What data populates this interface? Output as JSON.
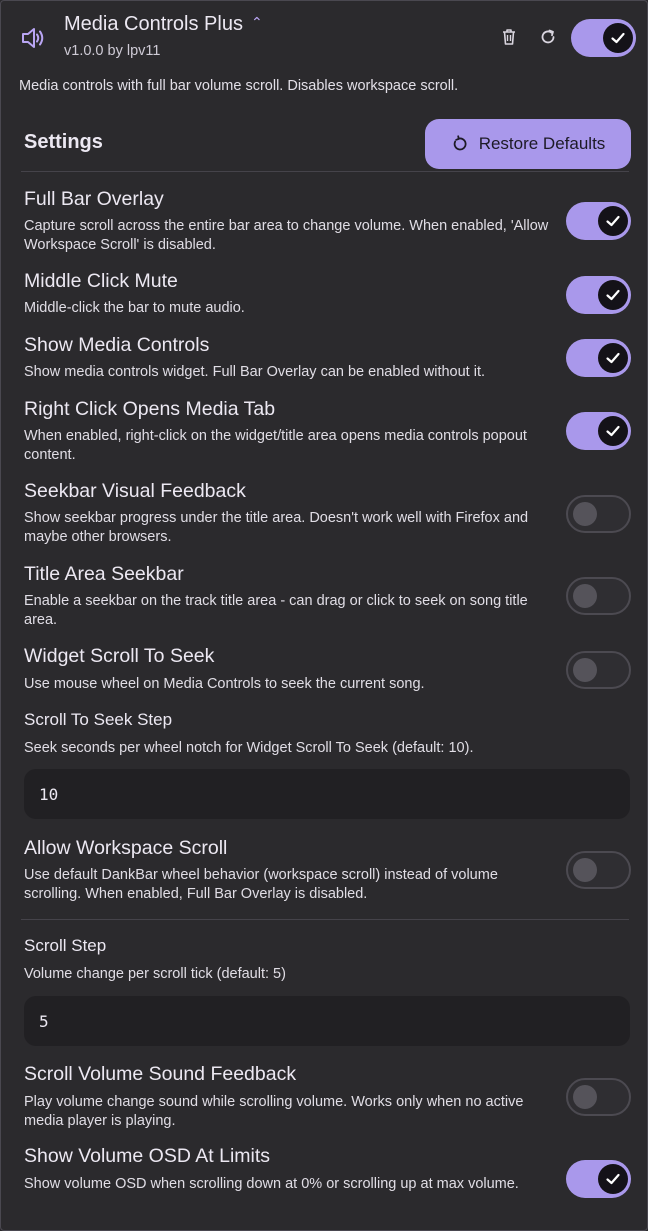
{
  "plugin": {
    "name": "Media Controls Plus",
    "version": "v1.0.0 by lpv11",
    "description": "Media controls with full bar volume scroll. Disables workspace scroll.",
    "enabled": true
  },
  "settings": {
    "heading": "Settings",
    "restore_label": "Restore Defaults"
  },
  "rows": [
    {
      "title": "Full Bar Overlay",
      "desc": "Capture scroll across the entire bar area to change volume. When enabled, 'Allow Workspace Scroll' is disabled.",
      "on": true
    },
    {
      "title": "Middle Click Mute",
      "desc": "Middle-click the bar to mute audio.",
      "on": true
    },
    {
      "title": "Show Media Controls",
      "desc": "Show media controls widget. Full Bar Overlay can be enabled without it.",
      "on": true
    },
    {
      "title": "Right Click Opens Media Tab",
      "desc": "When enabled, right-click on the widget/title area opens media controls popout content.",
      "on": true
    },
    {
      "title": "Seekbar Visual Feedback",
      "desc": "Show seekbar progress under the title area. Doesn't work well with Firefox and maybe other browsers.",
      "on": false
    },
    {
      "title": "Title Area Seekbar",
      "desc": "Enable a seekbar on the track title area - can drag or click to seek on song title area.",
      "on": false
    },
    {
      "title": "Widget Scroll To Seek",
      "desc": "Use mouse wheel on Media Controls to seek the current song.",
      "on": false
    }
  ],
  "seek_step": {
    "title": "Scroll To Seek Step",
    "desc": "Seek seconds per wheel notch for Widget Scroll To Seek (default: 10).",
    "value": "10"
  },
  "workspace_scroll": {
    "title": "Allow Workspace Scroll",
    "desc": "Use default DankBar wheel behavior (workspace scroll) instead of volume scrolling. When enabled, Full Bar Overlay is disabled.",
    "on": false
  },
  "scroll_step": {
    "title": "Scroll Step",
    "desc": "Volume change per scroll tick (default: 5)",
    "value": "5"
  },
  "rows2": [
    {
      "title": "Scroll Volume Sound Feedback",
      "desc": "Play volume change sound while scrolling volume. Works only when no active media player is playing.",
      "on": false
    },
    {
      "title": "Show Volume OSD At Limits",
      "desc": "Show volume OSD when scrolling down at 0% or scrolling up at max volume.",
      "on": true
    }
  ],
  "colors": {
    "accent": "#a998eb",
    "background": "#2b2a2d",
    "field": "#212023"
  }
}
